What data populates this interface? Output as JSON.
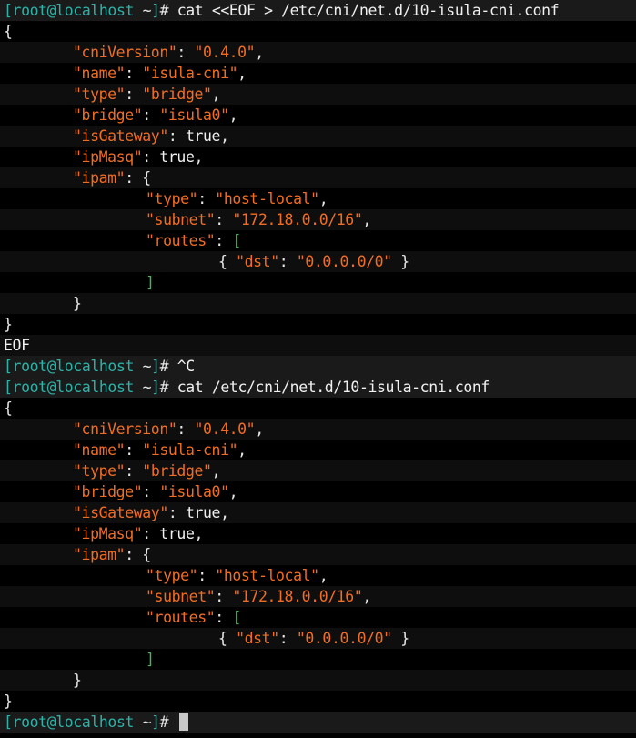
{
  "prompt": {
    "open_bracket": "[",
    "user_host": "root@localhost",
    "dir": " ~",
    "close_bracket": "]",
    "symbol": "# "
  },
  "commands": {
    "heredoc": "cat <<EOF > /etc/cni/net.d/10-isula-cni.conf",
    "interrupt": "^C",
    "show": "cat /etc/cni/net.d/10-isula-cni.conf"
  },
  "config": {
    "cniVersion_key": "\"cniVersion\"",
    "cniVersion_val": "\"0.4.0\"",
    "name_key": "\"name\"",
    "name_val": "\"isula-cni\"",
    "type_key": "\"type\"",
    "type_val": "\"bridge\"",
    "bridge_key": "\"bridge\"",
    "bridge_val": "\"isula0\"",
    "isGateway_key": "\"isGateway\"",
    "isGateway_val": "true",
    "ipMasq_key": "\"ipMasq\"",
    "ipMasq_val": "true",
    "ipam_key": "\"ipam\"",
    "ipam_type_key": "\"type\"",
    "ipam_type_val": "\"host-local\"",
    "subnet_key": "\"subnet\"",
    "subnet_val": "\"172.18.0.0/16\"",
    "routes_key": "\"routes\"",
    "dst_key": "\"dst\"",
    "dst_val": "\"0.0.0.0/0\""
  },
  "eof": "EOF",
  "colors": {
    "prompt_accent": "#2bb3a8",
    "string": "#f26d21",
    "array_bracket": "#3fb950",
    "text": "#e8e8e8",
    "background": "#000000"
  }
}
